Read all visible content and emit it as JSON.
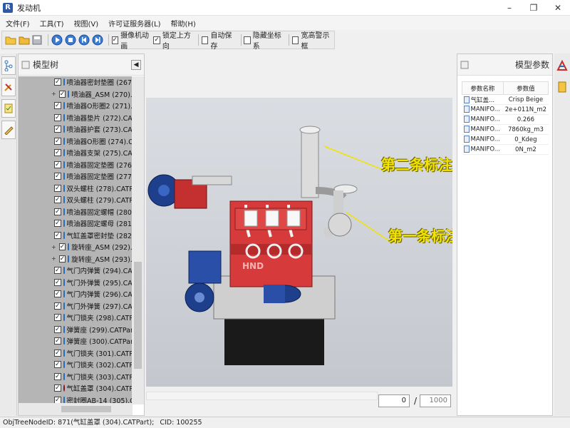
{
  "window": {
    "title": "发动机",
    "app_icon": "R"
  },
  "menu": [
    "文件(F)",
    "工具(T)",
    "视图(V)",
    "许可证服务器(L)",
    "帮助(H)"
  ],
  "toolbar": {
    "checks": [
      {
        "label": "摄像机动画",
        "checked": true
      },
      {
        "label": "锁定上方向",
        "checked": true
      },
      {
        "label": "自动保存",
        "checked": false
      },
      {
        "label": "隐藏坐标系",
        "checked": false
      },
      {
        "label": "宽高警示框",
        "checked": false
      }
    ]
  },
  "tree": {
    "title": "模型树",
    "rows": [
      {
        "label": "喷油器密封垫圈 (267).",
        "expander": "",
        "icon": "part"
      },
      {
        "label": "喷油器_ASM (270).CAT",
        "expander": "+",
        "icon": "part"
      },
      {
        "label": "喷油器O形圈2 (271).C",
        "expander": "",
        "icon": "part"
      },
      {
        "label": "喷油器垫片 (272).CATP",
        "expander": "",
        "icon": "part"
      },
      {
        "label": "喷油器护套 (273).CAT",
        "expander": "",
        "icon": "part"
      },
      {
        "label": "喷油器O形圈 (274).C",
        "expander": "",
        "icon": "part"
      },
      {
        "label": "喷油器支架 (275).CAT",
        "expander": "",
        "icon": "part"
      },
      {
        "label": "喷油器固定垫圈 (276)",
        "expander": "",
        "icon": "part"
      },
      {
        "label": "喷油器固定垫圈 (277)",
        "expander": "",
        "icon": "part"
      },
      {
        "label": "双头螺柱 (278).CATPa",
        "expander": "",
        "icon": "part"
      },
      {
        "label": "双头螺柱 (279).CATPa",
        "expander": "",
        "icon": "part"
      },
      {
        "label": "喷油器固定螺帽 (280)",
        "expander": "",
        "icon": "part"
      },
      {
        "label": "喷油器固定螺母 (281)",
        "expander": "",
        "icon": "part"
      },
      {
        "label": "气缸盖罩密封垫 (282)",
        "expander": "",
        "icon": "part"
      },
      {
        "label": "旋转座_ASM (292).CA",
        "expander": "+",
        "icon": "part"
      },
      {
        "label": "旋转座_ASM (293).CA",
        "expander": "+",
        "icon": "part"
      },
      {
        "label": "气门内弹簧 (294).CAT",
        "expander": "",
        "icon": "part"
      },
      {
        "label": "气门外弹簧 (295).CAT",
        "expander": "",
        "icon": "part"
      },
      {
        "label": "气门内弹簧 (296).CAT",
        "expander": "",
        "icon": "part"
      },
      {
        "label": "气门外弹簧 (297).CAT",
        "expander": "",
        "icon": "part"
      },
      {
        "label": "气门锁夹 (298).CATPa",
        "expander": "",
        "icon": "part"
      },
      {
        "label": "弹簧座 (299).CATPart",
        "expander": "",
        "icon": "part"
      },
      {
        "label": "弹簧座 (300).CATPart",
        "expander": "",
        "icon": "part"
      },
      {
        "label": "气门锁夹 (301).CATPa",
        "expander": "",
        "icon": "part"
      },
      {
        "label": "气门锁夹 (302).CATPa",
        "expander": "",
        "icon": "part"
      },
      {
        "label": "气门锁夹 (303).CATPa",
        "expander": "",
        "icon": "part"
      },
      {
        "label": "气缸盖罩 (304).CATPa",
        "expander": "",
        "icon": "part-red"
      },
      {
        "label": "密封圈AB-14 (305).C",
        "expander": "",
        "icon": "part"
      }
    ]
  },
  "viewport": {
    "annotation_2": "第二条标注示例",
    "annotation_1": "第一条标注示例",
    "engine_brand": "HND"
  },
  "frame": {
    "current": "0",
    "separator": "/",
    "total": "1000"
  },
  "params": {
    "title": "模型参数",
    "col_name": "参数名称",
    "col_value": "参数值",
    "rows": [
      {
        "name": "气缸盖...",
        "value": "Crisp Beige"
      },
      {
        "name": "MANIFO...",
        "value": "2e+011N_m2"
      },
      {
        "name": "MANIFO...",
        "value": "0.266"
      },
      {
        "name": "MANIFO...",
        "value": "7860kg_m3"
      },
      {
        "name": "MANIFO...",
        "value": "0_Kdeg"
      },
      {
        "name": "MANIFO...",
        "value": "0N_m2"
      }
    ]
  },
  "status": {
    "node_text": "ObjTreeNodeID: 871(气缸盖罩 (304).CATPart);",
    "cid_text": "CID: 100255"
  }
}
